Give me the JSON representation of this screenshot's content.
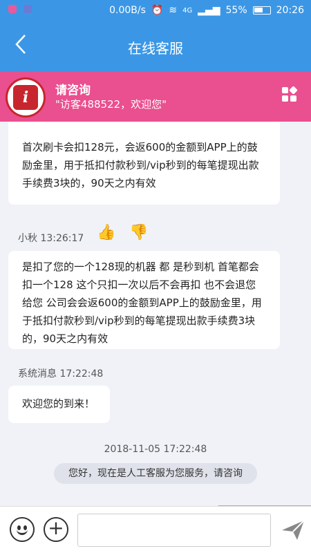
{
  "status_bar": {
    "speed": "0.00B/s",
    "network": "4G",
    "battery": "55%",
    "time": "20:26"
  },
  "nav": {
    "back_icon": "chevron-left-icon",
    "title": "在线客服"
  },
  "consult": {
    "title": "请咨询",
    "subtitle": "\"访客488522，欢迎您\"",
    "logo_letter": "i"
  },
  "messages": {
    "msg1": "首次刷卡会扣128元，会返600的金额到APP上的鼓励金里，用于抵扣付款秒到/vip秒到的每笔提现出款手续费3块的，90天之内有效",
    "msg2_meta": "小秋 13:26:17",
    "msg2": "是扣了您的一个128现的机器 都 是秒到机  首笔都会扣一个128 这个只扣一次以后不会再扣  也不会退您给您  公司会会返600的金额到APP上的鼓励金里，用于抵扣付款秒到/vip秒到的每笔提现出款手续费3块的，90天之内有效",
    "msg3_meta": "系统消息 17:22:48",
    "msg3": "欢迎您的到来！",
    "date": "2018-11-05 17:22:48",
    "system_notice": "您好，现在是人工客服为您服务，请咨询"
  },
  "input": {
    "placeholder": ""
  },
  "colors": {
    "nav_blue": "#3b97e6",
    "consult_pink": "#ea4f8f",
    "chat_bg": "#f0f2f7"
  }
}
